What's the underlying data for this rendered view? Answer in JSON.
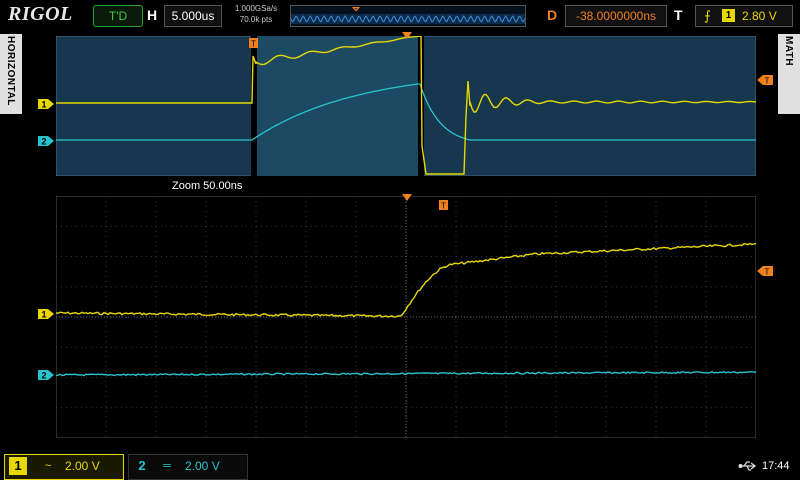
{
  "brand": "RIGOL",
  "header": {
    "run_state": "T'D",
    "horizontal_label": "H",
    "timebase": "5.000us",
    "sample_rate": "1.000GSa/s",
    "memory_points": "70.0k pts",
    "delay_label": "D",
    "delay_value": "-38.0000000ns",
    "trigger_label": "T",
    "trigger_source": "1",
    "trigger_level": "2.80 V"
  },
  "side_tabs": {
    "left": "HORIZONTAL",
    "right": "MATH"
  },
  "zoom_label": "Zoom  50.00ns",
  "channels": [
    {
      "number": "1",
      "coupling": "~",
      "scale": "2.00 V",
      "color": "#e8d800"
    },
    {
      "number": "2",
      "coupling": "═",
      "scale": "2.00 V",
      "color": "#27c3d0"
    }
  ],
  "markers": {
    "ch1": "1",
    "ch2": "2",
    "trigger": "T"
  },
  "status": {
    "usb_icon": "usb-icon",
    "clock": "17:44"
  },
  "colors": {
    "ch1": "#e8d800",
    "ch2": "#27c3d0",
    "trigger": "#f08020",
    "main_window_bg": "#16374d",
    "grid": "#3a3a3a"
  }
}
